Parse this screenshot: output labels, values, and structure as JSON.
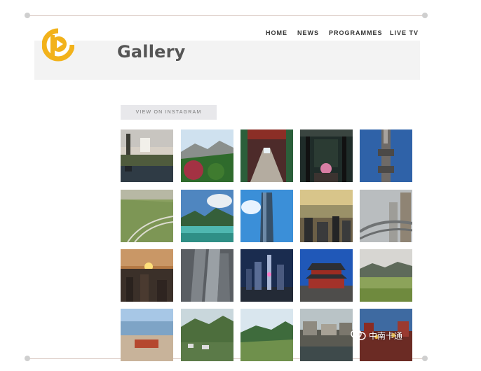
{
  "nav": {
    "items": [
      "HOME",
      "NEWS",
      "PROGRAMMES",
      "LIVE TV"
    ]
  },
  "page": {
    "title": "Gallery",
    "instagram_button": "VIEW ON INSTAGRAM"
  },
  "brand": {
    "accent": "#f2b21b"
  },
  "gallery": {
    "count": 20
  },
  "watermark": {
    "text": "中南卡通"
  }
}
